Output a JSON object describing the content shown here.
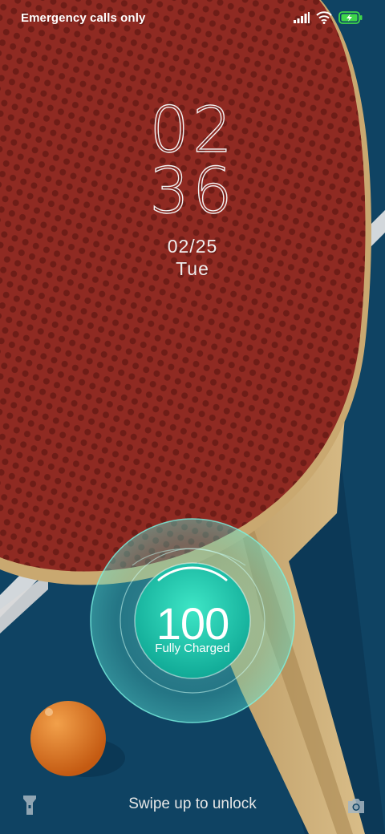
{
  "status_bar": {
    "carrier_text": "Emergency calls only",
    "icons": [
      "signal-icon",
      "wifi-icon",
      "battery-charging-icon"
    ]
  },
  "lock_screen": {
    "time_hour": "02",
    "time_minute": "36",
    "date": "02/25",
    "weekday": "Tue"
  },
  "charging": {
    "level": "100",
    "status": "Fully Charged",
    "battery_fraction": 1.0
  },
  "bottom": {
    "unlock_hint": "Swipe up to unlock",
    "left_shortcut": "flashlight-icon",
    "right_shortcut": "camera-icon"
  },
  "colors": {
    "background": "#0f4363",
    "paddle_rubber": "#8f2a22",
    "paddle_handle": "#c6a56e",
    "charge_accent": "#3fe0c3",
    "ball": "#d8691a"
  }
}
